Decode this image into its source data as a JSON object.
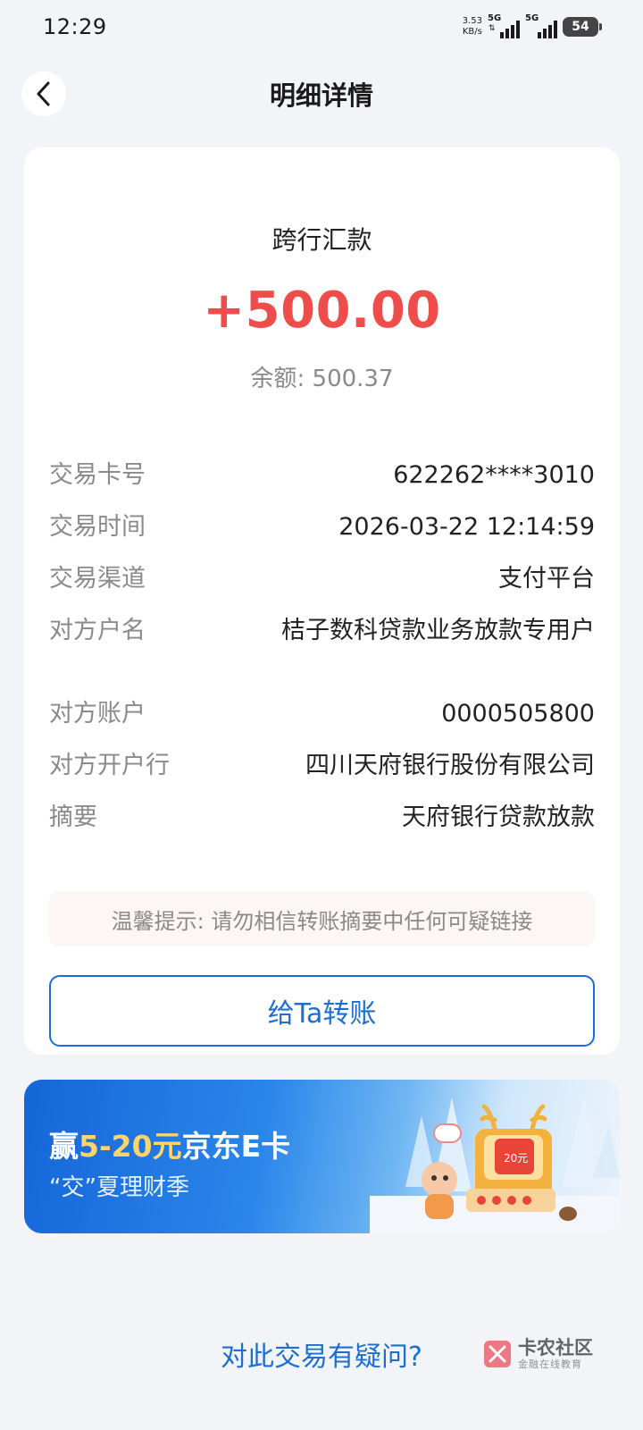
{
  "status_bar": {
    "time": "12:29",
    "net_speed_value": "3.53",
    "net_speed_unit": "KB/s",
    "sim1_label": "5G",
    "sim2_label": "5G",
    "battery": "54"
  },
  "nav": {
    "title": "明细详情"
  },
  "transaction": {
    "type": "跨行汇款",
    "amount": "+500.00",
    "balance_text": "余额: 500.37",
    "amount_color": "#ef4c4c"
  },
  "details": [
    {
      "label": "交易卡号",
      "value": "622262****3010"
    },
    {
      "label": "交易时间",
      "value": "2026-03-22 12:14:59"
    },
    {
      "label": "交易渠道",
      "value": "支付平台"
    },
    {
      "label": "对方户名",
      "value": "桔子数科贷款业务放款专用户"
    },
    {
      "label": "对方账户",
      "value": "0000505800"
    },
    {
      "label": "对方开户行",
      "value": "四川天府银行股份有限公司"
    },
    {
      "label": "摘要",
      "value": "天府银行贷款放款"
    }
  ],
  "tip": "温馨提示: 请勿相信转账摘要中任何可疑链接",
  "transfer_button": "给Ta转账",
  "promo": {
    "title_prefix": "赢",
    "title_highlight": "5-20元",
    "title_suffix": "京东E卡",
    "subtitle": "“交”夏理财季",
    "badge": "20元"
  },
  "question_link": "对此交易有疑问?",
  "watermark": {
    "main": "卡农社区",
    "sub": "金融在线教育"
  },
  "colors": {
    "accent": "#1c6fd1",
    "amount_red": "#ef4c4c",
    "background": "#f3f4f8"
  }
}
